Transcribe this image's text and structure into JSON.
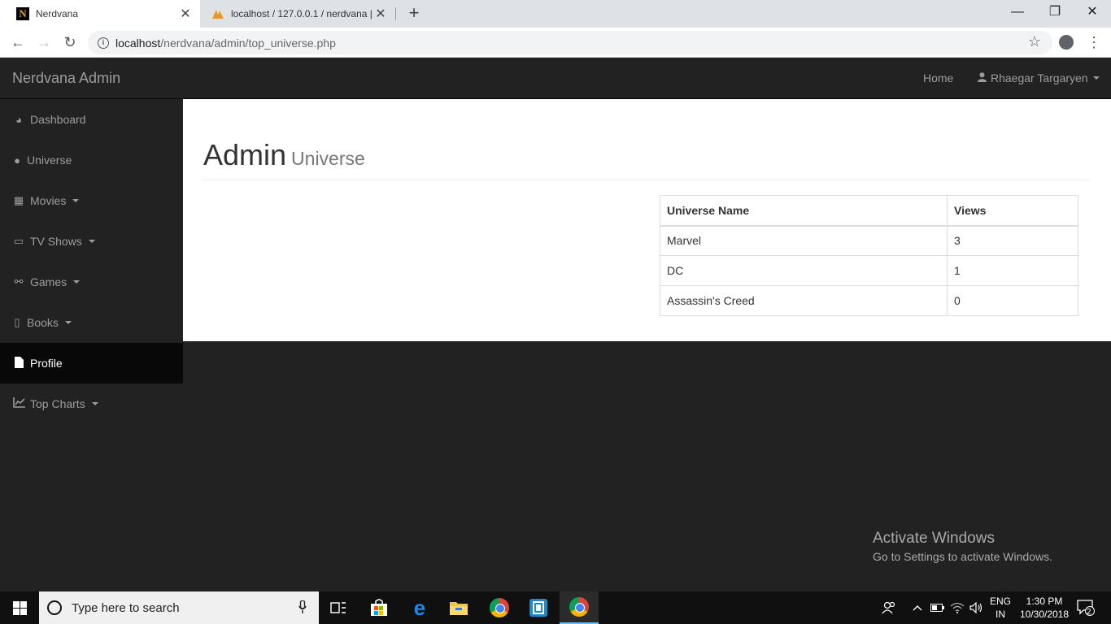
{
  "browser": {
    "tabs": [
      {
        "title": "Nerdvana",
        "active": true,
        "favicon": "N"
      },
      {
        "title": "localhost / 127.0.0.1 / nerdvana |",
        "active": false,
        "favicon": "pma-icon"
      }
    ],
    "url_host": "localhost",
    "url_path": "/nerdvana/admin/top_universe.php"
  },
  "navbar": {
    "brand": "Nerdvana Admin",
    "home": "Home",
    "user": "Rhaegar Targaryen"
  },
  "sidebar": {
    "items": [
      {
        "label": "Dashboard",
        "icon": "dashboard-icon",
        "dropdown": false,
        "active": false
      },
      {
        "label": "Universe",
        "icon": "globe-icon",
        "dropdown": false,
        "active": false
      },
      {
        "label": "Movies",
        "icon": "film-icon",
        "dropdown": true,
        "active": false
      },
      {
        "label": "TV Shows",
        "icon": "desktop-icon",
        "dropdown": true,
        "active": false
      },
      {
        "label": "Games",
        "icon": "gamepad-icon",
        "dropdown": true,
        "active": false
      },
      {
        "label": "Books",
        "icon": "book-icon",
        "dropdown": true,
        "active": false
      },
      {
        "label": "Profile",
        "icon": "file-icon",
        "dropdown": false,
        "active": true
      },
      {
        "label": "Top Charts",
        "icon": "line-chart-icon",
        "dropdown": true,
        "active": false
      }
    ]
  },
  "main": {
    "title": "Admin",
    "subtitle": "Universe",
    "table": {
      "headers": [
        "Universe Name",
        "Views"
      ],
      "rows": [
        [
          "Marvel",
          "3"
        ],
        [
          "DC",
          "1"
        ],
        [
          "Assassin's Creed",
          "0"
        ]
      ]
    }
  },
  "watermark": {
    "line1": "Activate Windows",
    "line2": "Go to Settings to activate Windows."
  },
  "taskbar": {
    "search_placeholder": "Type here to search",
    "lang_line1": "ENG",
    "lang_line2": "IN",
    "time": "1:30 PM",
    "date": "10/30/2018",
    "notifications": "2"
  }
}
